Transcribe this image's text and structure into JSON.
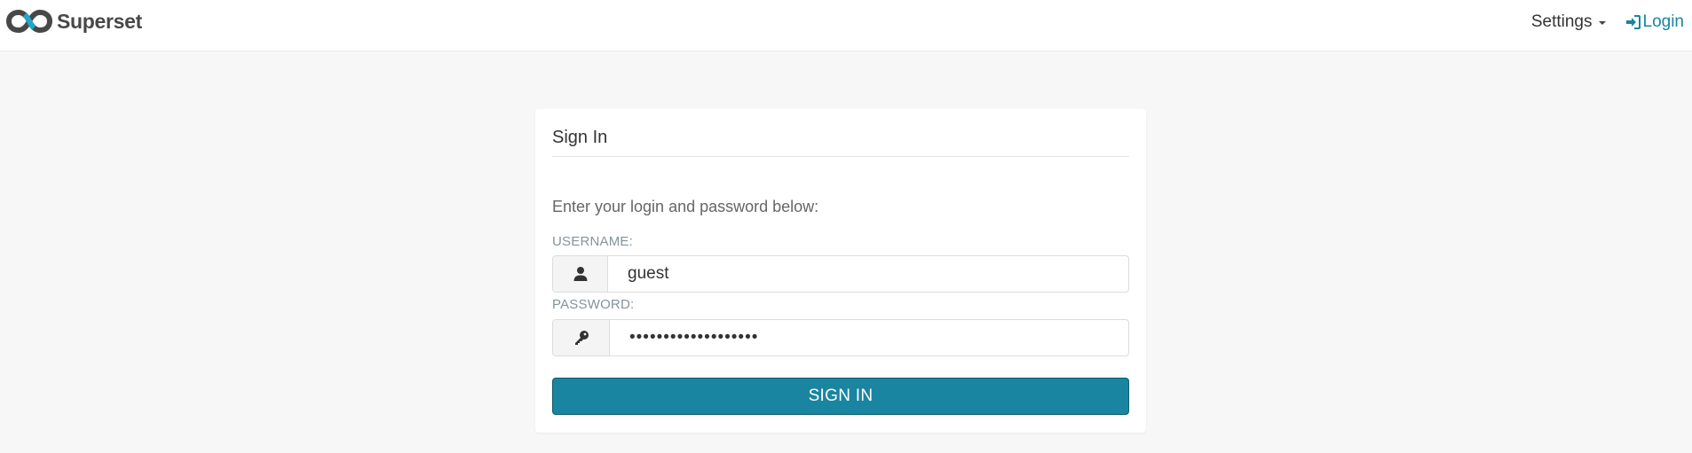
{
  "navbar": {
    "brand_name": "Superset",
    "settings_label": "Settings",
    "login_label": "Login",
    "brand_colors": {
      "dark": "#484848",
      "accent": "#20a7c9"
    },
    "link_color": "#1a85a0"
  },
  "login_panel": {
    "title": "Sign In",
    "instructions": "Enter your login and password below:",
    "username": {
      "label": "USERNAME:",
      "value": "guest",
      "icon": "user-icon"
    },
    "password": {
      "label": "PASSWORD:",
      "value": "•••••••••••••••••••",
      "icon": "key-icon"
    },
    "submit_label": "SIGN IN",
    "submit_color": "#1a85a0"
  }
}
